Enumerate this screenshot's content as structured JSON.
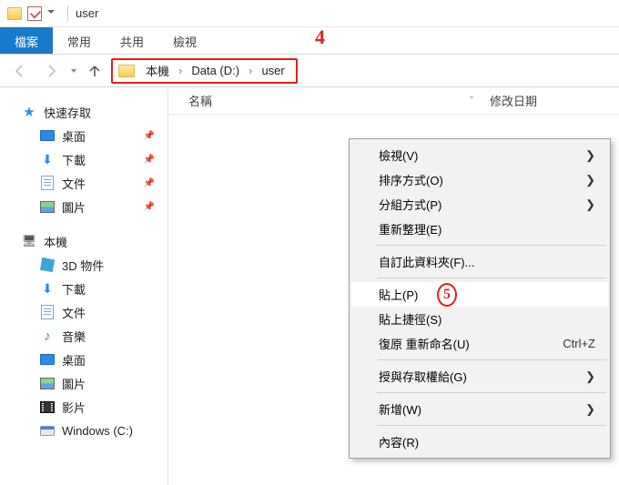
{
  "title": "user",
  "ribbon": {
    "file": "檔案",
    "home": "常用",
    "share": "共用",
    "view": "檢視"
  },
  "breadcrumb": [
    "本機",
    "Data (D:)",
    "user"
  ],
  "columns": {
    "name": "名稱",
    "date": "修改日期"
  },
  "sidebar": {
    "quick": "快速存取",
    "desktop": "桌面",
    "downloads": "下載",
    "documents": "文件",
    "pictures": "圖片",
    "pc": "本機",
    "objects3d": "3D 物件",
    "downloads2": "下載",
    "documents2": "文件",
    "music": "音樂",
    "desktop2": "桌面",
    "pictures2": "圖片",
    "videos": "影片",
    "cdrive": "Windows (C:)"
  },
  "context": {
    "view": "檢視(V)",
    "sort": "排序方式(O)",
    "group": "分組方式(P)",
    "refresh": "重新整理(E)",
    "customize": "自訂此資料夾(F)...",
    "paste": "貼上(P)",
    "pasteShortcut": "貼上捷徑(S)",
    "undoRename": "復原 重新命名(U)",
    "undoShortcut": "Ctrl+Z",
    "grantAccess": "授與存取權給(G)",
    "new": "新增(W)",
    "properties": "內容(R)"
  },
  "annotations": {
    "four": "4",
    "five": "5"
  }
}
